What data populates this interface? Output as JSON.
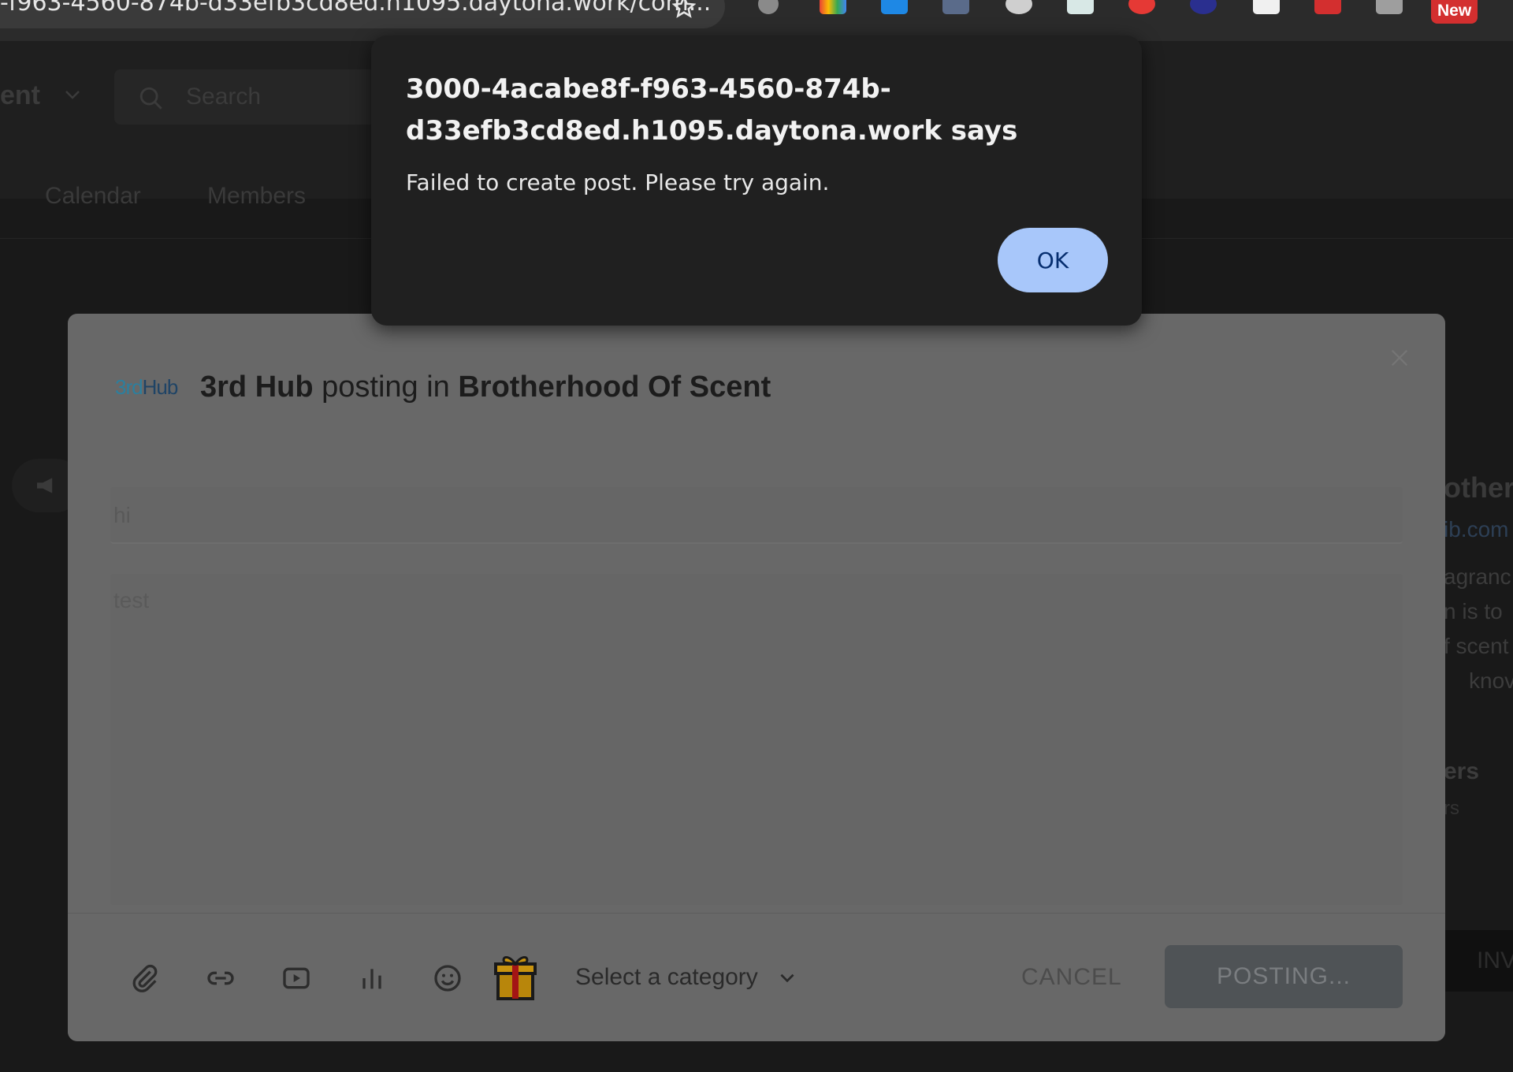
{
  "browser": {
    "url": "-f963-4560-874b-d33efb3cd8ed.h1095.daytona.work/com...",
    "new_badge": "New"
  },
  "background": {
    "community_title_fragment": "ent",
    "search_placeholder": "Search",
    "tabs": [
      "Calendar",
      "Members"
    ],
    "right_panel_fragments": [
      "other",
      "ib.com",
      "agranc",
      "n is to",
      "f scent",
      "knov",
      "ers",
      "rs",
      "INV"
    ]
  },
  "modal": {
    "logo_text_a": "3rd",
    "logo_text_b": "Hub",
    "author": "3rd Hub",
    "posting_in": "posting in",
    "community": "Brotherhood Of Scent",
    "title_value": "hi",
    "body_value": "test",
    "toolbar_icons": [
      "attachment-icon",
      "link-icon",
      "video-icon",
      "poll-icon",
      "emoji-icon",
      "gift-icon"
    ],
    "category_placeholder": "Select a category",
    "cancel_label": "CANCEL",
    "posting_label": "POSTING..."
  },
  "alert": {
    "title": "3000-4acabe8f-f963-4560-874b-d33efb3cd8ed.h1095.daytona.work says",
    "message": "Failed to create post. Please try again.",
    "ok_label": "OK"
  },
  "colors": {
    "ok_button_bg": "#a8c7fa",
    "ok_button_text": "#062e6f",
    "alert_bg": "#202020",
    "modal_bg": "#686868",
    "posting_button_bg": "#4f5356"
  }
}
